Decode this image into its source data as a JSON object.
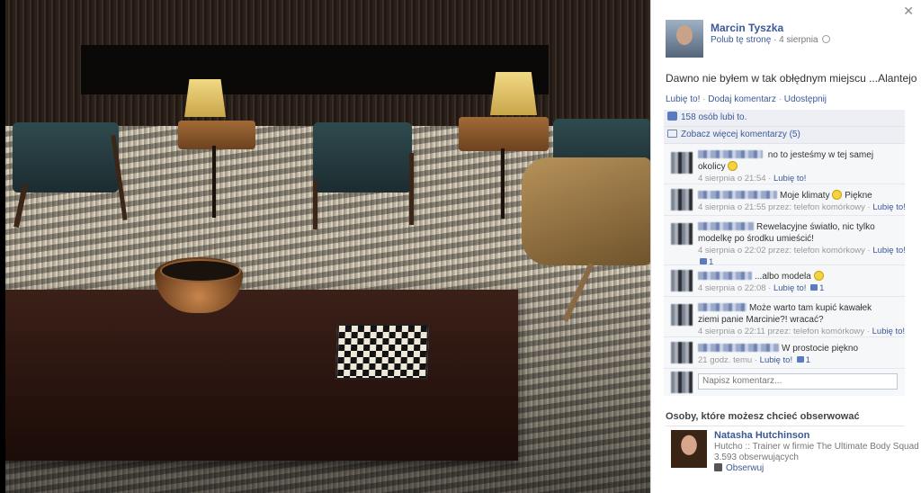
{
  "post": {
    "page_name": "Marcin Tyszka",
    "like_page_label": "Polub tę stronę",
    "date": "4 sierpnia",
    "text": "Dawno nie byłem w tak obłędnym miejscu ...Alantejo",
    "actions": {
      "like": "Lubię to!",
      "comment": "Dodaj komentarz",
      "share": "Udostępnij",
      "separator": "·"
    },
    "likes_count_text": "158 osób lubi to.",
    "more_comments_text": "Zobacz więcej komentarzy (5)"
  },
  "comments": [
    {
      "text_line1": "no to jesteśmy w tej samej",
      "text_line2": "okolicy",
      "smiley": true,
      "meta": "4 sierpnia o 21:54 ·",
      "like_label": "Lubię to!",
      "likes": ""
    },
    {
      "text_line1": "Moje klimaty",
      "text_line2": "Piękne",
      "smiley": true,
      "meta": "4 sierpnia o 21:55 przez: telefon komórkowy ·",
      "like_label": "Lubię to!",
      "likes": ""
    },
    {
      "text_line1": "Rewelacyjne światło, nic tylko",
      "text_line2": "modelkę po środku umieścić!",
      "smiley": false,
      "meta": "4 sierpnia o 22:02 przez: telefon komórkowy ·",
      "like_label": "Lubię to!",
      "likes": "1"
    },
    {
      "text_line1": "...albo modela",
      "text_line2": "",
      "smiley": true,
      "meta": "4 sierpnia o 22:08 ·",
      "like_label": "Lubię to!",
      "likes": "1"
    },
    {
      "text_line1": "Może warto tam kupić kawałek",
      "text_line2": "ziemi panie Marcinie?! wracać?",
      "smiley": false,
      "meta": "4 sierpnia o 22:11 przez: telefon komórkowy ·",
      "like_label": "Lubię to!",
      "likes": ""
    },
    {
      "text_line1": "W prostocie piękno",
      "text_line2": "",
      "smiley": false,
      "meta": "21 godz. temu ·",
      "like_label": "Lubię to!",
      "likes": "1"
    }
  ],
  "comment_input": {
    "placeholder": "Napisz komentarz..."
  },
  "suggestions": {
    "title": "Osoby, które możesz chcieć obserwować",
    "person": {
      "name": "Natasha Hutchinson",
      "description": "Hutcho :: Trainer w firmie The Ultimate Body Squad",
      "followers": "3.593 obserwujących",
      "follow_label": "Obserwuj"
    }
  },
  "icons": {
    "close": "close-icon",
    "globe": "globe-icon",
    "like": "like-icon",
    "comment": "comment-icon",
    "smiley": "smiley-icon",
    "rss": "rss-icon"
  },
  "colors": {
    "link": "#3b5998",
    "panel_bg": "#ffffff",
    "feedback_bg": "#edeff4"
  }
}
